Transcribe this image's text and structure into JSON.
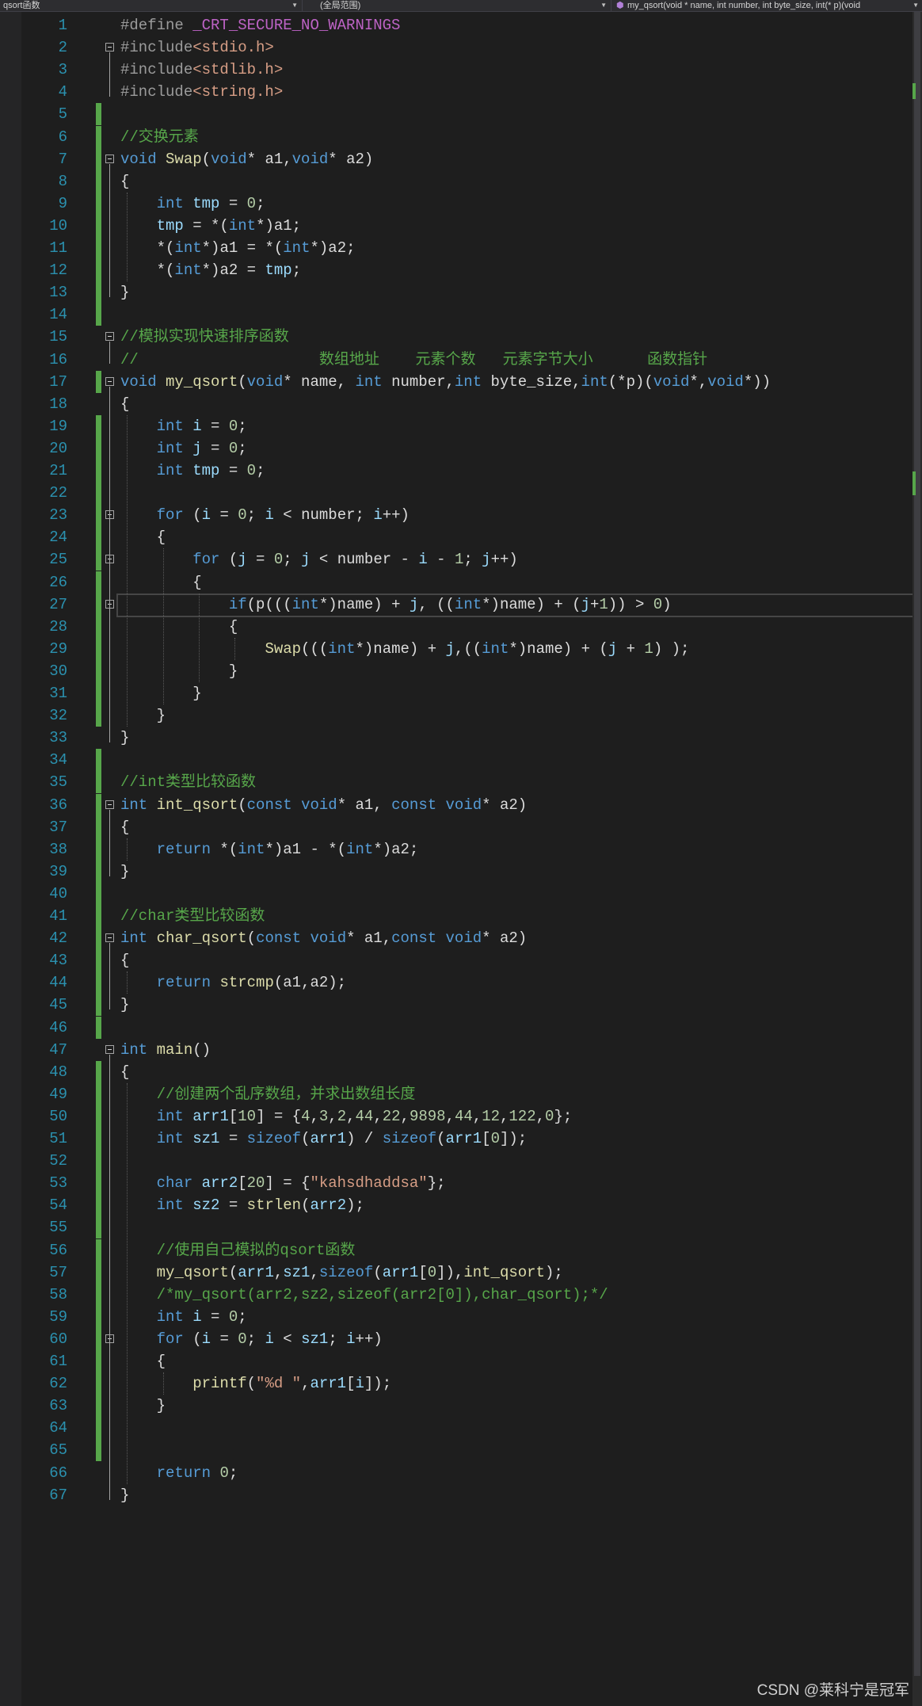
{
  "topbar": {
    "project": "qsort函数",
    "scope": "(全局范围)",
    "member": "my_qsort(void * name, int number, int byte_size, int(* p)(void"
  },
  "lines": [
    "<span class=\"pp\">#define </span><span class=\"mc\">_CRT_SECURE_NO_WARNINGS</span>",
    "<span class=\"pp\">#include</span><span class=\"st\">&lt;stdio.h&gt;</span>",
    "<span class=\"pp\">#include</span><span class=\"st\">&lt;stdlib.h&gt;</span>",
    "<span class=\"pp\">#include</span><span class=\"st\">&lt;string.h&gt;</span>",
    "",
    "<span class=\"cm\">//交换元素</span>",
    "<span class=\"kw\">void</span> <span class=\"fn\">Swap</span>(<span class=\"kw\">void</span>* a1,<span class=\"kw\">void</span>* a2)",
    "{",
    "    <span class=\"kw\">int</span> <span class=\"vr\">tmp</span> = <span class=\"nm\">0</span>;",
    "    <span class=\"vr\">tmp</span> = *(<span class=\"kw\">int</span>*)a1;",
    "    *(<span class=\"kw\">int</span>*)a1 = *(<span class=\"kw\">int</span>*)a2;",
    "    *(<span class=\"kw\">int</span>*)a2 = <span class=\"vr\">tmp</span>;",
    "}",
    "",
    "<span class=\"cm\">//模拟实现快速排序函数</span>",
    "<span class=\"cm\">//                    数组地址    元素个数   元素字节大小      函数指针</span>",
    "<span class=\"kw\">void</span> <span class=\"fn\">my_qsort</span>(<span class=\"kw\">void</span>* name, <span class=\"kw\">int</span> number,<span class=\"kw\">int</span> byte_size,<span class=\"kw\">int</span>(*p)(<span class=\"kw\">void</span>*,<span class=\"kw\">void</span>*))",
    "{",
    "    <span class=\"kw\">int</span> <span class=\"vr\">i</span> = <span class=\"nm\">0</span>;",
    "    <span class=\"kw\">int</span> <span class=\"vr\">j</span> = <span class=\"nm\">0</span>;",
    "    <span class=\"kw\">int</span> <span class=\"vr\">tmp</span> = <span class=\"nm\">0</span>;",
    "",
    "    <span class=\"kw\">for</span> (<span class=\"vr\">i</span> = <span class=\"nm\">0</span>; <span class=\"vr\">i</span> &lt; number; <span class=\"vr\">i</span>++)",
    "    {",
    "        <span class=\"kw\">for</span> (<span class=\"vr\">j</span> = <span class=\"nm\">0</span>; <span class=\"vr\">j</span> &lt; number - <span class=\"vr\">i</span> - <span class=\"nm\">1</span>; <span class=\"vr\">j</span>++)",
    "        {",
    "            <span class=\"kw\">if</span>(p(((<span class=\"kw\">int</span>*)name) + <span class=\"vr\">j</span>, ((<span class=\"kw\">int</span>*)name) + (<span class=\"vr\">j</span>+<span class=\"nm\">1</span>)) &gt; <span class=\"nm\">0</span>)",
    "            {",
    "                <span class=\"fn\">Swap</span>(((<span class=\"kw\">int</span>*)name) + <span class=\"vr\">j</span>,((<span class=\"kw\">int</span>*)name) + (<span class=\"vr\">j</span> + <span class=\"nm\">1</span>) );",
    "            }",
    "        }",
    "    }",
    "}",
    "",
    "<span class=\"cm\">//int类型比较函数</span>",
    "<span class=\"kw\">int</span> <span class=\"fn\">int_qsort</span>(<span class=\"kw\">const</span> <span class=\"kw\">void</span>* a1, <span class=\"kw\">const</span> <span class=\"kw\">void</span>* a2)",
    "{",
    "    <span class=\"kw\">return</span> *(<span class=\"kw\">int</span>*)a1 - *(<span class=\"kw\">int</span>*)a2;",
    "}",
    "",
    "<span class=\"cm\">//char类型比较函数</span>",
    "<span class=\"kw\">int</span> <span class=\"fn\">char_qsort</span>(<span class=\"kw\">const</span> <span class=\"kw\">void</span>* a1,<span class=\"kw\">const</span> <span class=\"kw\">void</span>* a2)",
    "{",
    "    <span class=\"kw\">return</span> <span class=\"fn\">strcmp</span>(a1,a2);",
    "}",
    "",
    "<span class=\"kw\">int</span> <span class=\"fn\">main</span>()",
    "{",
    "    <span class=\"cm\">//创建两个乱序数组，并求出数组长度</span>",
    "    <span class=\"kw\">int</span> <span class=\"vr\">arr1</span>[<span class=\"nm\">10</span>] = {<span class=\"nm\">4</span>,<span class=\"nm\">3</span>,<span class=\"nm\">2</span>,<span class=\"nm\">44</span>,<span class=\"nm\">22</span>,<span class=\"nm\">9898</span>,<span class=\"nm\">44</span>,<span class=\"nm\">12</span>,<span class=\"nm\">122</span>,<span class=\"nm\">0</span>};",
    "    <span class=\"kw\">int</span> <span class=\"vr\">sz1</span> = <span class=\"kw\">sizeof</span>(<span class=\"vr\">arr1</span>) / <span class=\"kw\">sizeof</span>(<span class=\"vr\">arr1</span>[<span class=\"nm\">0</span>]);",
    "",
    "    <span class=\"kw\">char</span> <span class=\"vr\">arr2</span>[<span class=\"nm\">20</span>] = {<span class=\"st\">\"kahsdhaddsa\"</span>};",
    "    <span class=\"kw\">int</span> <span class=\"vr\">sz2</span> = <span class=\"fn\">strlen</span>(<span class=\"vr\">arr2</span>);",
    "",
    "    <span class=\"cm\">//使用自己模拟的qsort函数</span>",
    "    <span class=\"fn\">my_qsort</span>(<span class=\"vr\">arr1</span>,<span class=\"vr\">sz1</span>,<span class=\"kw\">sizeof</span>(<span class=\"vr\">arr1</span>[<span class=\"nm\">0</span>]),<span class=\"fn\">int_qsort</span>);",
    "    <span class=\"cm\">/*my_qsort(arr2,sz2,sizeof(arr2[0]),char_qsort);*/</span>",
    "    <span class=\"kw\">int</span> <span class=\"vr\">i</span> = <span class=\"nm\">0</span>;",
    "    <span class=\"kw\">for</span> (<span class=\"vr\">i</span> = <span class=\"nm\">0</span>; <span class=\"vr\">i</span> &lt; <span class=\"vr\">sz1</span>; <span class=\"vr\">i</span>++)",
    "    {",
    "        <span class=\"fn\">printf</span>(<span class=\"st\">\"%d \"</span>,<span class=\"vr\">arr1</span>[<span class=\"vr\">i</span>]);",
    "    }",
    "",
    "",
    "    <span class=\"kw\">return</span> <span class=\"nm\">0</span>;",
    "}"
  ],
  "watermark": "CSDN @莱科宁是冠军"
}
